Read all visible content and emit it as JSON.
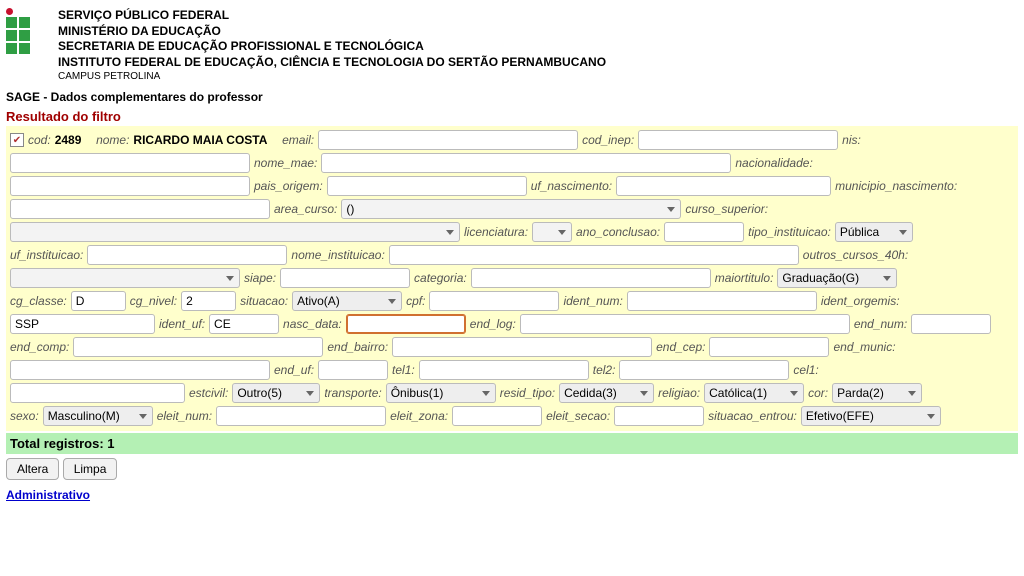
{
  "header": {
    "l1": "SERVIÇO PÚBLICO FEDERAL",
    "l2": "MINISTÉRIO DA EDUCAÇÃO",
    "l3": "SECRETARIA DE EDUCAÇÃO PROFISSIONAL E TECNOLÓGICA",
    "l4": "INSTITUTO FEDERAL DE EDUCAÇÃO, CIÊNCIA E TECNOLOGIA DO SERTÃO PERNAMBUCANO",
    "l5": "CAMPUS PETROLINA"
  },
  "sage_bar": "SAGE - Dados complementares do professor",
  "filter_title": "Resultado do filtro",
  "labels": {
    "cod": "cod:",
    "nome": "nome:",
    "email": "email:",
    "cod_inep": "cod_inep:",
    "nis": "nis:",
    "nome_mae": "nome_mae:",
    "nacionalidade": "nacionalidade:",
    "pais_origem": "pais_origem:",
    "uf_nascimento": "uf_nascimento:",
    "municipio_nascimento": "municipio_nascimento:",
    "area_curso": "area_curso:",
    "curso_superior": "curso_superior:",
    "licenciatura": "licenciatura:",
    "ano_conclusao": "ano_conclusao:",
    "tipo_instituicao": "tipo_instituicao:",
    "uf_instituicao": "uf_instituicao:",
    "nome_instituicao": "nome_instituicao:",
    "outros_cursos_40h": "outros_cursos_40h:",
    "siape": "siape:",
    "categoria": "categoria:",
    "maiortitulo": "maiortitulo:",
    "cg_classe": "cg_classe:",
    "cg_nivel": "cg_nivel:",
    "situacao": "situacao:",
    "cpf": "cpf:",
    "ident_num": "ident_num:",
    "ident_orgemis": "ident_orgemis:",
    "ident_uf": "ident_uf:",
    "nasc_data": "nasc_data:",
    "end_log": "end_log:",
    "end_num": "end_num:",
    "end_comp": "end_comp:",
    "end_bairro": "end_bairro:",
    "end_cep": "end_cep:",
    "end_munic": "end_munic:",
    "end_uf": "end_uf:",
    "tel1": "tel1:",
    "tel2": "tel2:",
    "cel1": "cel1:",
    "estcivil": "estcivil:",
    "transporte": "transporte:",
    "resid_tipo": "resid_tipo:",
    "religiao": "religiao:",
    "cor": "cor:",
    "sexo": "sexo:",
    "eleit_num": "eleit_num:",
    "eleit_zona": "eleit_zona:",
    "eleit_secao": "eleit_secao:",
    "situacao_entrou": "situacao_entrou:"
  },
  "values": {
    "cod": "2489",
    "nome": "RICARDO MAIA COSTA",
    "area_curso": "()",
    "tipo_instituicao": "Pública",
    "maiortitulo": "Graduação(G)",
    "cg_classe": "D",
    "cg_nivel": "2",
    "situacao": "Ativo(A)",
    "ident_orgemis": "SSP",
    "ident_uf": "CE",
    "estcivil": "Outro(5)",
    "transporte": "Ônibus(1)",
    "resid_tipo": "Cedida(3)",
    "religiao": "Católica(1)",
    "cor": "Parda(2)",
    "sexo": "Masculino(M)",
    "situacao_entrou": "Efetivo(EFE)"
  },
  "totals": "Total registros: 1",
  "buttons": {
    "altera": "Altera",
    "limpa": "Limpa"
  },
  "admin_link": "Administrativo"
}
